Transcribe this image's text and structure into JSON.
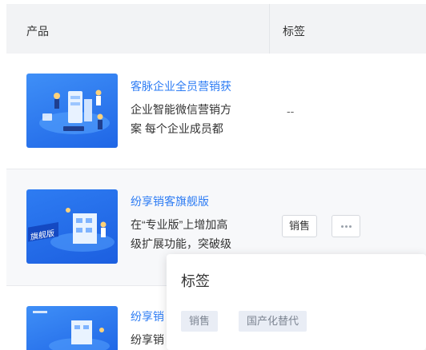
{
  "table": {
    "headers": {
      "product": "产品",
      "tags": "标签"
    },
    "rows": [
      {
        "title": "客脉企业全员营销获",
        "desc_lines": [
          "企业智能微信营销方",
          "案 每个企业成员都"
        ],
        "tag_text": "--"
      },
      {
        "title": "纷享销客旗舰版",
        "desc_lines": [
          "在“专业版”上增加高",
          "级扩展功能，突破级"
        ],
        "thumb_label": "旗舰版",
        "tag": "销售",
        "more_label": "···"
      },
      {
        "title": "纷享销",
        "desc_lines": [
          "纷享销"
        ]
      }
    ]
  },
  "popover": {
    "title": "标签",
    "tags": [
      "销售",
      "国产化替代"
    ]
  },
  "colors": {
    "link": "#2d7cf4",
    "header_bg": "#f2f3f5",
    "thumb_blue": "#2a74ef"
  }
}
